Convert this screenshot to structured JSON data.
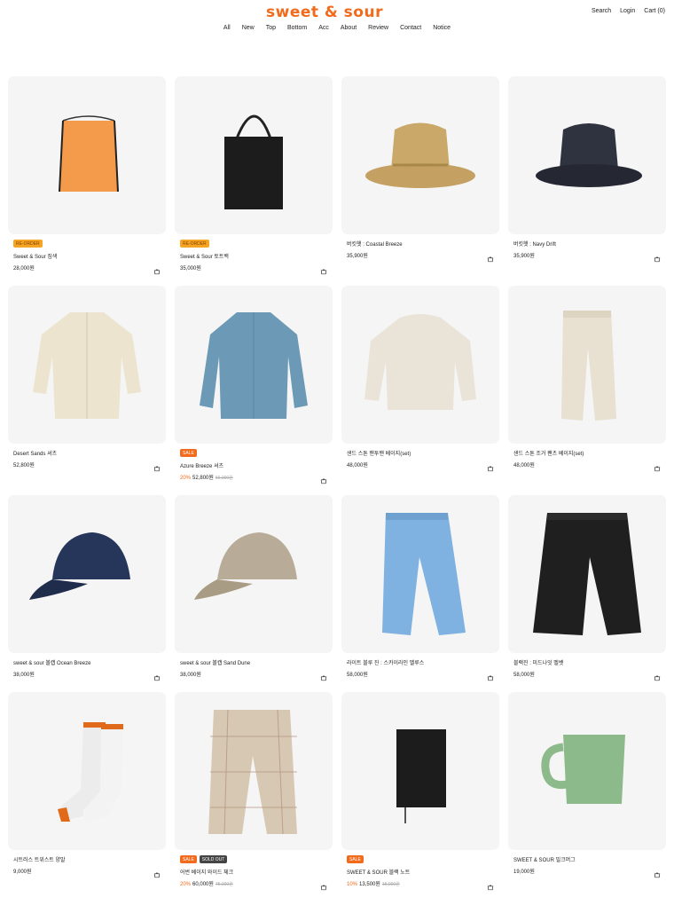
{
  "header": {
    "logo": "sweet & sour",
    "util": [
      "Search",
      "Login",
      "Cart (0)"
    ],
    "nav": [
      "All",
      "New",
      "Top",
      "Bottom",
      "Acc",
      "About",
      "Review",
      "Contact",
      "Notice"
    ]
  },
  "colors": {
    "accent": "#f26a1b",
    "reorder": "#f5a524",
    "soldout": "#444444",
    "thumb_bg": "#f5f5f5"
  },
  "products": [
    {
      "image": "orange-drawstring-bag",
      "badges": [
        {
          "text": "RE-ORDER",
          "type": "reorder"
        }
      ],
      "name": "Sweet & Sour 짐색",
      "discount": "",
      "price": "28,000원",
      "original": ""
    },
    {
      "image": "black-tote-bag",
      "badges": [
        {
          "text": "RE-ORDER",
          "type": "reorder"
        }
      ],
      "name": "Sweet & Sour 토트백",
      "discount": "",
      "price": "35,000원",
      "original": ""
    },
    {
      "image": "khaki-bucket-hat",
      "badges": [],
      "name": "버킷햇 : Coastal Breeze",
      "discount": "",
      "price": "35,900원",
      "original": ""
    },
    {
      "image": "navy-bucket-hat",
      "badges": [],
      "name": "버킷햇 : Navy Drift",
      "discount": "",
      "price": "35,900원",
      "original": ""
    },
    {
      "image": "cream-shirt",
      "badges": [],
      "name": "Desert Sands 셔츠",
      "discount": "",
      "price": "52,800원",
      "original": ""
    },
    {
      "image": "blue-shirt",
      "badges": [
        {
          "text": "SALE",
          "type": "sale"
        }
      ],
      "name": "Azure Breeze 셔츠",
      "discount": "20%",
      "price": "52,800원",
      "original": "66,000원"
    },
    {
      "image": "cream-sweatshirt",
      "badges": [],
      "name": "샌드 스톤 맨투맨 베이지(set)",
      "discount": "",
      "price": "48,000원",
      "original": ""
    },
    {
      "image": "cream-joggers",
      "badges": [],
      "name": "샌드 스톤 조거 팬츠 베이지(set)",
      "discount": "",
      "price": "48,000원",
      "original": ""
    },
    {
      "image": "navy-cap",
      "badges": [],
      "name": "sweet & sour 볼캡 Ocean Breeze",
      "discount": "",
      "price": "38,000원",
      "original": ""
    },
    {
      "image": "beige-cap",
      "badges": [],
      "name": "sweet & sour 볼캡 Sand Dune",
      "discount": "",
      "price": "38,000원",
      "original": ""
    },
    {
      "image": "blue-jeans",
      "badges": [],
      "name": "라이트 블루 진 : 스카이라인 벨루스",
      "discount": "",
      "price": "58,000원",
      "original": ""
    },
    {
      "image": "black-cargo-pants",
      "badges": [],
      "name": "블랙진 : 미드나잇 벨벳",
      "discount": "",
      "price": "58,000원",
      "original": ""
    },
    {
      "image": "white-socks",
      "badges": [],
      "name": "시트러스 트위스트 양말",
      "discount": "",
      "price": "9,000원",
      "original": ""
    },
    {
      "image": "plaid-pants",
      "badges": [
        {
          "text": "SALE",
          "type": "sale"
        },
        {
          "text": "SOLD OUT",
          "type": "soldout"
        }
      ],
      "name": "어번 베이지 와이드 체크",
      "discount": "20%",
      "price": "60,000원",
      "original": "75,000원"
    },
    {
      "image": "black-notebook",
      "badges": [
        {
          "text": "SALE",
          "type": "sale"
        }
      ],
      "name": "SWEET & SOUR 블랙 노트",
      "discount": "10%",
      "price": "13,500원",
      "original": "15,000원"
    },
    {
      "image": "green-mug",
      "badges": [],
      "name": "SWEET & SOUR 밀크머그",
      "discount": "",
      "price": "19,000원",
      "original": ""
    }
  ]
}
